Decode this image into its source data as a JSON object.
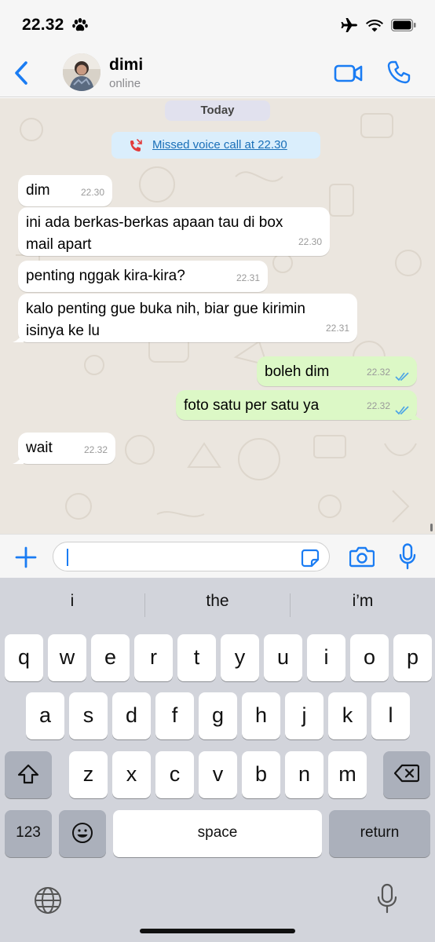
{
  "status_bar": {
    "time": "22.32",
    "icons": [
      "paw-icon",
      "airplane-icon",
      "wifi-icon",
      "battery-icon"
    ]
  },
  "header": {
    "back_icon": "chevron-left-icon",
    "contact_name": "dimi",
    "contact_status": "online",
    "actions": [
      "video-call-icon",
      "phone-icon"
    ]
  },
  "chat": {
    "day_label": "Today",
    "missed_call": "Missed voice call at 22.30",
    "messages": [
      {
        "dir": "in",
        "text": "dim",
        "time": "22.30"
      },
      {
        "dir": "in",
        "text": "ini ada berkas-berkas apaan tau di box\nmail apart",
        "time": "22.30"
      },
      {
        "dir": "in",
        "text": "penting nggak kira-kira?",
        "time": "22.31"
      },
      {
        "dir": "in",
        "text": "kalo penting gue buka nih, biar gue kirimin\nisinya ke lu",
        "time": "22.31"
      },
      {
        "dir": "out",
        "text": "boleh dim",
        "time": "22.32",
        "status": "read"
      },
      {
        "dir": "out",
        "text": "foto satu per satu ya",
        "time": "22.32",
        "status": "read"
      },
      {
        "dir": "in",
        "text": "wait",
        "time": "22.32"
      }
    ]
  },
  "input": {
    "value": "",
    "icons": [
      "plus-icon",
      "sticker-icon",
      "camera-icon",
      "microphone-icon"
    ]
  },
  "keyboard": {
    "suggestions": [
      "i",
      "the",
      "i’m"
    ],
    "row1": [
      "q",
      "w",
      "e",
      "r",
      "t",
      "y",
      "u",
      "i",
      "o",
      "p"
    ],
    "row2": [
      "a",
      "s",
      "d",
      "f",
      "g",
      "h",
      "j",
      "k",
      "l"
    ],
    "row3": [
      "z",
      "x",
      "c",
      "v",
      "b",
      "n",
      "m"
    ],
    "numbers_label": "123",
    "space_label": "space",
    "return_label": "return"
  },
  "colors": {
    "accent": "#1a7cf3",
    "outgoing_bubble": "#dcf8c6",
    "incoming_bubble": "#ffffff",
    "chat_background": "#ebe6df",
    "missed_call_bg": "#daeefc",
    "missed_call_icon": "#e23b3b",
    "read_ticks": "#4aa3e6"
  }
}
